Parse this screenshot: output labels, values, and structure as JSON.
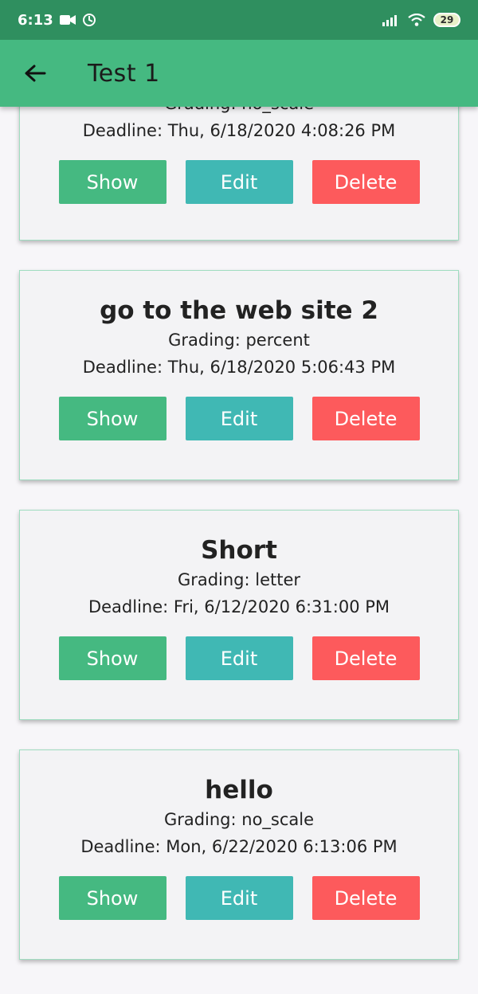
{
  "status_bar": {
    "time": "6:13",
    "battery": "29"
  },
  "app_bar": {
    "title": "Test 1"
  },
  "colors": {
    "status_bar": "#2f8f5f",
    "app_bar": "#45b981",
    "show": "#45b981",
    "edit": "#40b8b4",
    "delete": "#fd5a5c"
  },
  "cards": [
    {
      "title": "",
      "grading": "Grading: no_scale",
      "deadline": "Deadline: Thu, 6/18/2020 4:08:26 PM",
      "show": "Show",
      "edit": "Edit",
      "delete": "Delete"
    },
    {
      "title": "go to the web site 2",
      "grading": "Grading: percent",
      "deadline": "Deadline: Thu, 6/18/2020 5:06:43 PM",
      "show": "Show",
      "edit": "Edit",
      "delete": "Delete"
    },
    {
      "title": "Short",
      "grading": "Grading: letter",
      "deadline": "Deadline: Fri, 6/12/2020 6:31:00 PM",
      "show": "Show",
      "edit": "Edit",
      "delete": "Delete"
    },
    {
      "title": "hello",
      "grading": "Grading: no_scale",
      "deadline": "Deadline: Mon, 6/22/2020 6:13:06 PM",
      "show": "Show",
      "edit": "Edit",
      "delete": "Delete"
    }
  ]
}
